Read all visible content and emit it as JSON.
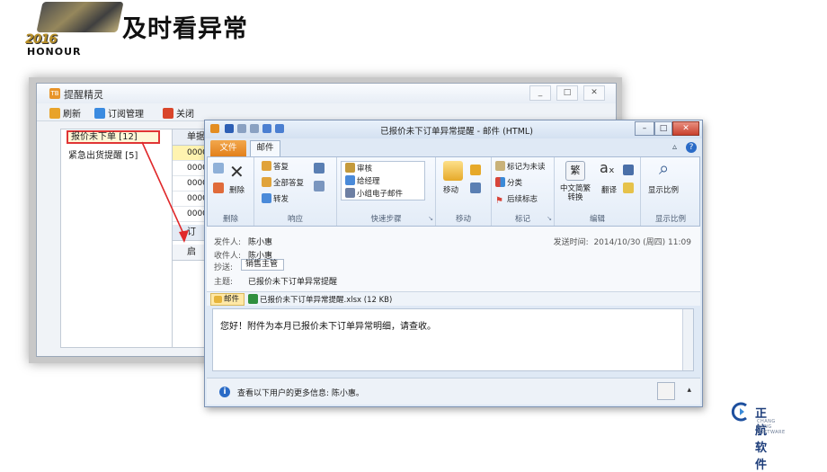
{
  "slide": {
    "title": "及时看异常",
    "logo_year": "2016",
    "logo_text": "HONOUR",
    "company_name": "正航软件",
    "company_sub": "CHANG HANG SOFTWARE"
  },
  "back_window": {
    "title": "提醒精灵",
    "toolbar": {
      "refresh": "刷新",
      "subscribe": "订阅管理",
      "close": "关闭"
    },
    "list_items": [
      {
        "label": "报价未下单 [12]",
        "selected": true
      },
      {
        "label": "紧急出货提醒 [5]",
        "selected": false
      }
    ],
    "grid_header": "单据",
    "grid_rows": [
      "0000",
      "0000",
      "0000",
      "0000",
      "0000"
    ],
    "section2_label": "订",
    "section2_col": "启"
  },
  "outlook": {
    "title": "已报价未下订单异常提醒 - 邮件 (HTML)",
    "tabs": {
      "file": "文件",
      "mail": "邮件"
    },
    "ribbon": {
      "delete_group": {
        "label": "删除",
        "delete": "删除"
      },
      "respond_group": {
        "label": "响应",
        "reply": "答复",
        "reply_all": "全部答复",
        "forward": "转发"
      },
      "quicksteps_group": {
        "label": "快速步骤",
        "items": [
          "审核",
          "给经理",
          "小组电子邮件"
        ]
      },
      "move_group": {
        "label": "移动",
        "move": "移动"
      },
      "tags_group": {
        "label": "标记",
        "mark_unread": "标记为未读",
        "categorize": "分类",
        "follow_up": "后续标志"
      },
      "editing_group": {
        "label": "编辑",
        "convert": "中文简繁转换",
        "translate": "翻译"
      },
      "zoom_group": {
        "label": "显示比例",
        "zoom": "显示比例"
      }
    },
    "header": {
      "from_label": "发件人:",
      "from": "陈小惠",
      "to_label": "收件人:",
      "to": "陈小惠",
      "cc_label": "抄送:",
      "cc": "销售主管",
      "subject_label": "主题:",
      "subject": "已报价未下订单异常提醒",
      "sent_label": "发送时间:",
      "sent": "2014/10/30 (周四) 11:09"
    },
    "attachments": {
      "mail_tab": "邮件",
      "file": "已报价未下订单异常提醒.xlsx (12 KB)"
    },
    "body": "您好！附件为本月已报价未下订单异常明细，请查收。",
    "people_pane": "查看以下用户的更多信息: 陈小惠。"
  }
}
